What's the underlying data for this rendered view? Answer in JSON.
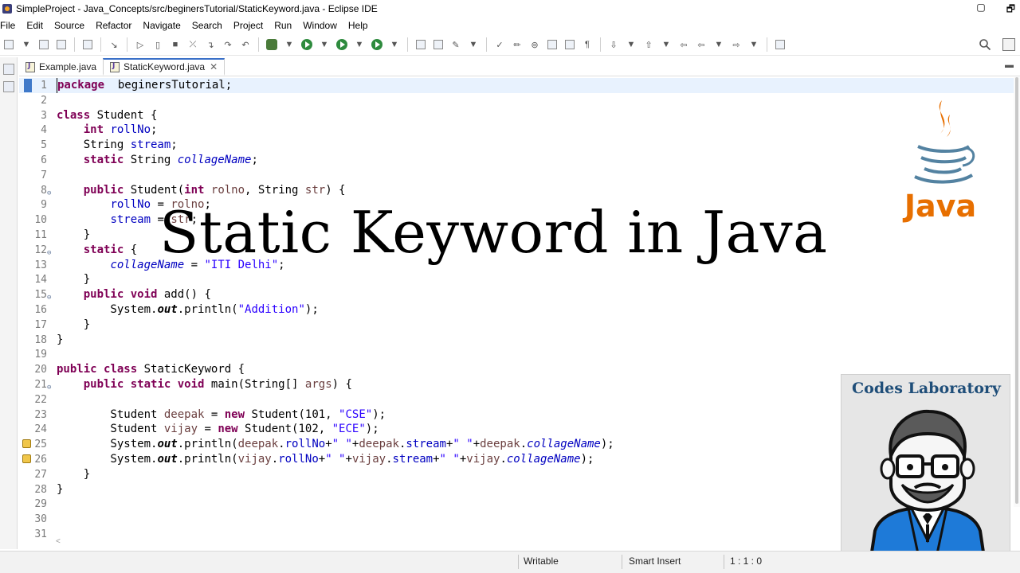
{
  "window": {
    "title": "SimpleProject - Java_Concepts/src/beginersTutorial/StaticKeyword.java - Eclipse IDE",
    "restore_glyph": "🗗",
    "minimize_glyph": "▢"
  },
  "menu": [
    "File",
    "Edit",
    "Source",
    "Refactor",
    "Navigate",
    "Search",
    "Project",
    "Run",
    "Window",
    "Help"
  ],
  "tabs": [
    {
      "label": "Example.java",
      "active": false
    },
    {
      "label": "StaticKeyword.java",
      "active": true,
      "close": "✕"
    }
  ],
  "editor": {
    "lines": [
      {
        "n": "1",
        "current": true,
        "bookmark": true,
        "segs": [
          [
            "kw",
            "package"
          ],
          [
            "",
            "  beginersTutorial;"
          ]
        ]
      },
      {
        "n": "2",
        "segs": []
      },
      {
        "n": "3",
        "segs": [
          [
            "kw",
            "class"
          ],
          [
            "",
            " Student {"
          ]
        ]
      },
      {
        "n": "4",
        "segs": [
          [
            "",
            "    "
          ],
          [
            "kw",
            "int"
          ],
          [
            "",
            " "
          ],
          [
            "fld",
            "rollNo"
          ],
          [
            "",
            ";"
          ]
        ]
      },
      {
        "n": "5",
        "segs": [
          [
            "",
            "    String "
          ],
          [
            "fld",
            "stream"
          ],
          [
            "",
            ";"
          ]
        ]
      },
      {
        "n": "6",
        "segs": [
          [
            "",
            "    "
          ],
          [
            "kw",
            "static"
          ],
          [
            "",
            " String "
          ],
          [
            "sfld",
            "collageName"
          ],
          [
            "",
            ";"
          ]
        ]
      },
      {
        "n": "7",
        "segs": []
      },
      {
        "n": "8",
        "fold": true,
        "segs": [
          [
            "",
            "    "
          ],
          [
            "kw",
            "public"
          ],
          [
            "",
            " Student("
          ],
          [
            "kw",
            "int"
          ],
          [
            "",
            " "
          ],
          [
            "param",
            "rolno"
          ],
          [
            "",
            ", String "
          ],
          [
            "param",
            "str"
          ],
          [
            "",
            ") {"
          ]
        ]
      },
      {
        "n": "9",
        "segs": [
          [
            "",
            "        "
          ],
          [
            "fld",
            "rollNo"
          ],
          [
            "",
            " = "
          ],
          [
            "param",
            "rolno"
          ],
          [
            "",
            ";"
          ]
        ]
      },
      {
        "n": "10",
        "segs": [
          [
            "",
            "        "
          ],
          [
            "fld",
            "stream"
          ],
          [
            "",
            " = "
          ],
          [
            "param",
            "str"
          ],
          [
            "",
            ";"
          ]
        ]
      },
      {
        "n": "11",
        "segs": [
          [
            "",
            "    }"
          ]
        ]
      },
      {
        "n": "12",
        "fold": true,
        "segs": [
          [
            "",
            "    "
          ],
          [
            "kw",
            "static"
          ],
          [
            "",
            " {"
          ]
        ]
      },
      {
        "n": "13",
        "segs": [
          [
            "",
            "        "
          ],
          [
            "sfld",
            "collageName"
          ],
          [
            "",
            " = "
          ],
          [
            "str",
            "\"ITI Delhi\""
          ],
          [
            "",
            ";"
          ]
        ]
      },
      {
        "n": "14",
        "segs": [
          [
            "",
            "    }"
          ]
        ]
      },
      {
        "n": "15",
        "fold": true,
        "segs": [
          [
            "",
            "    "
          ],
          [
            "kw",
            "public"
          ],
          [
            "",
            " "
          ],
          [
            "kw",
            "void"
          ],
          [
            "",
            " add() {"
          ]
        ]
      },
      {
        "n": "16",
        "segs": [
          [
            "",
            "        System."
          ],
          [
            "sm",
            "out"
          ],
          [
            "",
            ".println("
          ],
          [
            "str",
            "\"Addition\""
          ],
          [
            "",
            ");"
          ]
        ]
      },
      {
        "n": "17",
        "segs": [
          [
            "",
            "    }"
          ]
        ]
      },
      {
        "n": "18",
        "segs": [
          [
            "",
            "}"
          ]
        ]
      },
      {
        "n": "19",
        "segs": []
      },
      {
        "n": "20",
        "segs": [
          [
            "kw",
            "public"
          ],
          [
            "",
            " "
          ],
          [
            "kw",
            "class"
          ],
          [
            "",
            " StaticKeyword {"
          ]
        ]
      },
      {
        "n": "21",
        "fold": true,
        "segs": [
          [
            "",
            "    "
          ],
          [
            "kw",
            "public"
          ],
          [
            "",
            " "
          ],
          [
            "kw",
            "static"
          ],
          [
            "",
            " "
          ],
          [
            "kw",
            "void"
          ],
          [
            "",
            " main(String[] "
          ],
          [
            "param",
            "args"
          ],
          [
            "",
            ") {"
          ]
        ]
      },
      {
        "n": "22",
        "segs": []
      },
      {
        "n": "23",
        "segs": [
          [
            "",
            "        Student "
          ],
          [
            "param",
            "deepak"
          ],
          [
            "",
            " = "
          ],
          [
            "kw",
            "new"
          ],
          [
            "",
            " Student(101, "
          ],
          [
            "str",
            "\"CSE\""
          ],
          [
            "",
            ");"
          ]
        ]
      },
      {
        "n": "24",
        "segs": [
          [
            "",
            "        Student "
          ],
          [
            "param",
            "vijay"
          ],
          [
            "",
            " = "
          ],
          [
            "kw",
            "new"
          ],
          [
            "",
            " Student(102, "
          ],
          [
            "str",
            "\"ECE\""
          ],
          [
            "",
            ");"
          ]
        ]
      },
      {
        "n": "25",
        "warn": true,
        "segs": [
          [
            "",
            "        System."
          ],
          [
            "sm",
            "out"
          ],
          [
            "",
            ".println("
          ],
          [
            "param",
            "deepak"
          ],
          [
            "",
            "."
          ],
          [
            "fld",
            "rollNo"
          ],
          [
            "",
            "+"
          ],
          [
            "str",
            "\" \""
          ],
          [
            "",
            "+"
          ],
          [
            "param",
            "deepak"
          ],
          [
            "",
            "."
          ],
          [
            "fld",
            "stream"
          ],
          [
            "",
            "+"
          ],
          [
            "str",
            "\" \""
          ],
          [
            "",
            "+"
          ],
          [
            "param",
            "deepak"
          ],
          [
            "",
            "."
          ],
          [
            "sfld",
            "collageName"
          ],
          [
            "",
            ");"
          ]
        ]
      },
      {
        "n": "26",
        "warn": true,
        "segs": [
          [
            "",
            "        System."
          ],
          [
            "sm",
            "out"
          ],
          [
            "",
            ".println("
          ],
          [
            "param",
            "vijay"
          ],
          [
            "",
            "."
          ],
          [
            "fld",
            "rollNo"
          ],
          [
            "",
            "+"
          ],
          [
            "str",
            "\" \""
          ],
          [
            "",
            "+"
          ],
          [
            "param",
            "vijay"
          ],
          [
            "",
            "."
          ],
          [
            "fld",
            "stream"
          ],
          [
            "",
            "+"
          ],
          [
            "str",
            "\" \""
          ],
          [
            "",
            "+"
          ],
          [
            "param",
            "vijay"
          ],
          [
            "",
            "."
          ],
          [
            "sfld",
            "collageName"
          ],
          [
            "",
            ");"
          ]
        ]
      },
      {
        "n": "27",
        "segs": [
          [
            "",
            "    }"
          ]
        ]
      },
      {
        "n": "28",
        "segs": [
          [
            "",
            "}"
          ]
        ]
      },
      {
        "n": "29",
        "segs": []
      },
      {
        "n": "30",
        "segs": []
      },
      {
        "n": "31",
        "segs": []
      }
    ]
  },
  "overlay": {
    "title": "Static Keyword in Java"
  },
  "java_logo": {
    "text": "Java"
  },
  "badge": {
    "title": "Codes Laboratory"
  },
  "status": {
    "writable": "Writable",
    "insert_mode": "Smart Insert",
    "position": "1 : 1 : 0"
  },
  "colors": {
    "keyword": "#7f0055",
    "field": "#0000c0",
    "string": "#2a00ff",
    "current_line": "#e8f2fe",
    "java_orange": "#e76f00",
    "java_blue": "#5382a1",
    "badge_title": "#1f4e79"
  }
}
